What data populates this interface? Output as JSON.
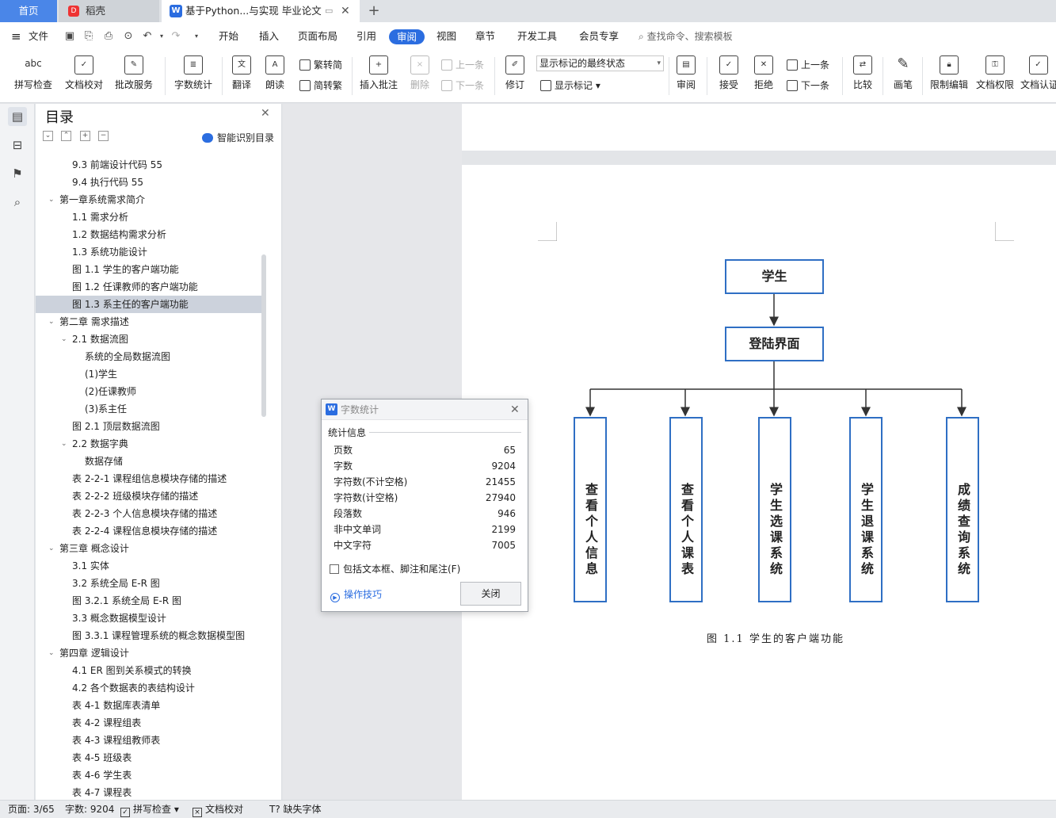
{
  "tabs": {
    "home": "首页",
    "daoke": "稻壳",
    "document": "基于Python...与实现 毕业论文",
    "add": "+"
  },
  "menu": {
    "file": "文件",
    "items": [
      "开始",
      "插入",
      "页面布局",
      "引用",
      "审阅",
      "视图",
      "章节",
      "开发工具",
      "会员专享"
    ],
    "search": "查找命令、搜索模板"
  },
  "ribbon": {
    "spell": "拼写检查",
    "doc_check": "文档校对",
    "batch": "批改服务",
    "wordcount": "字数统计",
    "translate": "翻译",
    "read": "朗读",
    "trad": "繁转简",
    "simp": "简转繁",
    "insert_comment": "插入批注",
    "delete": "删除",
    "prev": "上一条",
    "next": "下一条",
    "revise": "修订",
    "markup_state": "显示标记的最终状态",
    "show_markup": "显示标记",
    "review": "审阅",
    "accept": "接受",
    "reject": "拒绝",
    "prev2": "上一条",
    "next2": "下一条",
    "compare": "比较",
    "pen": "画笔",
    "restrict": "限制编辑",
    "doc_rights": "文档权限",
    "doc_auth": "文档认证"
  },
  "toc": {
    "title": "目录",
    "smart": "智能识别目录",
    "items": [
      "9.3  前端设计代码  55",
      "9.4  执行代码  55",
      "第一章系统需求简介",
      "1.1 需求分析",
      "1.2  数据结构需求分析",
      "1.3 系统功能设计",
      "图 1.1  学生的客户端功能",
      "图 1.2  任课教师的客户端功能",
      "图 1.3  系主任的客户端功能",
      "第二章  需求描述",
      "2.1  数据流图",
      "系统的全局数据流图",
      "(1)学生",
      "(2)任课教师",
      "(3)系主任",
      "图 2.1  顶层数据流图",
      "2.2  数据字典",
      "数据存储",
      "表 2-2-1  课程组信息模块存储的描述",
      "表 2-2-2  班级模块存储的描述",
      "表 2-2-3  个人信息模块存储的描述",
      "表 2-2-4  课程信息模块存储的描述",
      "第三章    概念设计",
      "3.1  实体",
      "3.2  系统全局 E-R 图",
      "图 3.2.1  系统全局 E-R 图",
      "3.3  概念数据模型设计",
      "图 3.3.1  课程管理系统的概念数据模型图",
      "第四章  逻辑设计",
      "4.1 ER 图到关系模式的转换",
      "4.2    各个数据表的表结构设计",
      "表 4-1  数据库表清单",
      "表 4-2  课程组表",
      "表 4-3  课程组教师表",
      "表 4-5  班级表",
      "表 4-6  学生表",
      "表 4-7  课程表"
    ]
  },
  "diagram": {
    "root": "学生",
    "login": "登陆界面",
    "children": [
      "查看个人信息",
      "查看个人课表",
      "学生选课系统",
      "学生退课系统",
      "成绩查询系统"
    ],
    "caption": "图 1.1  学生的客户端功能"
  },
  "dialog": {
    "title": "字数统计",
    "section": "统计信息",
    "rows": [
      {
        "label": "页数",
        "value": "65"
      },
      {
        "label": "字数",
        "value": "9204"
      },
      {
        "label": "字符数(不计空格)",
        "value": "21455"
      },
      {
        "label": "字符数(计空格)",
        "value": "27940"
      },
      {
        "label": "段落数",
        "value": "946"
      },
      {
        "label": "非中文单词",
        "value": "2199"
      },
      {
        "label": "中文字符",
        "value": "7005"
      }
    ],
    "checkbox": "包括文本框、脚注和尾注(F)",
    "tips": "操作技巧",
    "close": "关闭"
  },
  "status": {
    "page": "页面: 3/65",
    "words": "字数: 9204",
    "spell": "拼写检查",
    "doc_check": "文档校对",
    "missing_font": "缺失字体"
  },
  "colors": {
    "accent": "#2b6de0",
    "node_border": "#2f6fc4"
  }
}
